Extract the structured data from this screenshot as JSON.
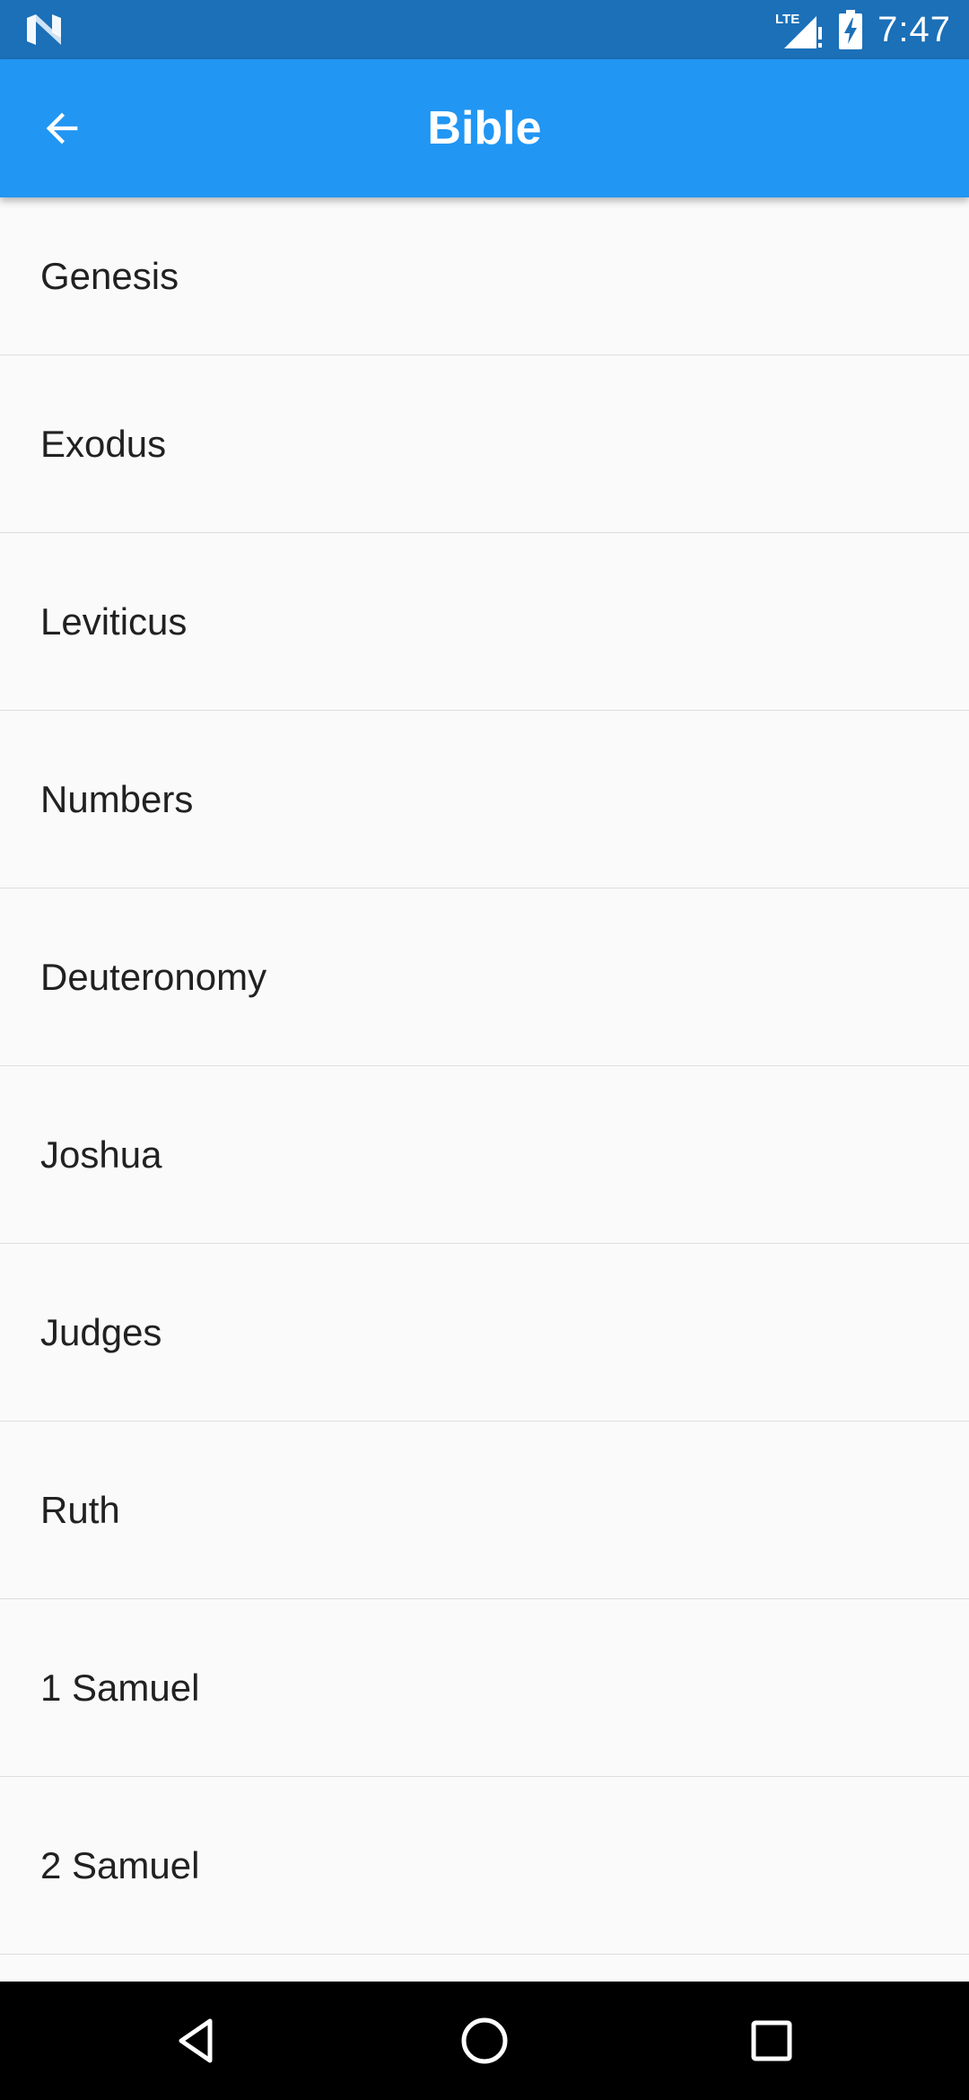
{
  "status_bar": {
    "time": "7:47",
    "network_label": "LTE",
    "icons": [
      "n-logo-icon",
      "lte-signal-icon",
      "battery-charging-icon"
    ]
  },
  "app_bar": {
    "title": "Bible",
    "back_icon": "arrow-back-icon",
    "background_color": "#2196f3"
  },
  "books": [
    "Genesis",
    "Exodus",
    "Leviticus",
    "Numbers",
    "Deuteronomy",
    "Joshua",
    "Judges",
    "Ruth",
    "1 Samuel",
    "2 Samuel"
  ],
  "nav_bar": {
    "icons": [
      "nav-back-icon",
      "nav-home-icon",
      "nav-recents-icon"
    ]
  },
  "colors": {
    "status_bar": "#1b70b8",
    "app_bar": "#2196f3",
    "list_background": "#fafafa",
    "divider": "#dedede",
    "text": "#212121"
  }
}
